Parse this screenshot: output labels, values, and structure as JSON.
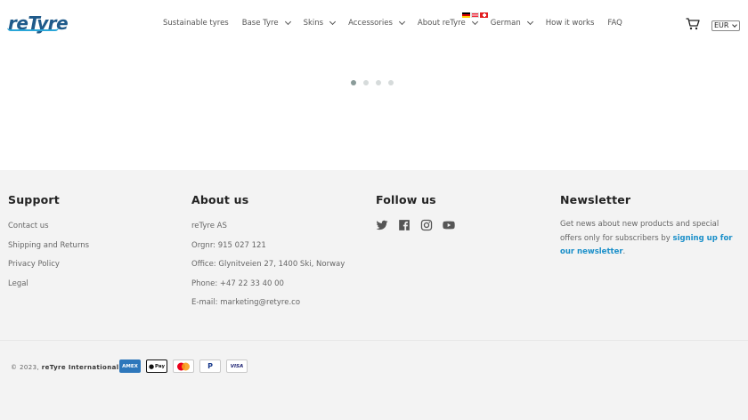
{
  "header": {
    "logo_text": "reTyre",
    "nav": [
      {
        "label": "Sustainable tyres",
        "has_dropdown": false
      },
      {
        "label": "Base Tyre",
        "has_dropdown": true
      },
      {
        "label": "Skins",
        "has_dropdown": true
      },
      {
        "label": "Accessories",
        "has_dropdown": true
      },
      {
        "label": "About reTyre",
        "has_dropdown": true
      },
      {
        "label": "German",
        "has_dropdown": true
      },
      {
        "label": "How it works",
        "has_dropdown": false
      },
      {
        "label": "FAQ",
        "has_dropdown": false
      }
    ],
    "cart_icon": "cart-icon",
    "currency": "EUR"
  },
  "carousel": {
    "slides": 4,
    "active_index": 0
  },
  "footer": {
    "support": {
      "title": "Support",
      "links": [
        "Contact us",
        "Shipping and Returns",
        "Privacy Policy",
        "Legal"
      ]
    },
    "about": {
      "title": "About us",
      "lines": [
        "reTyre AS",
        "Orgnr: 915 027 121",
        "Office: Glynitveien 27, 1400 Ski, Norway",
        "Phone: +47 22 33 40 00",
        "E-mail: marketing@retyre.co"
      ]
    },
    "follow": {
      "title": "Follow us",
      "icons": [
        "twitter-icon",
        "facebook-icon",
        "instagram-icon",
        "youtube-icon"
      ]
    },
    "newsletter": {
      "title": "Newsletter",
      "text": "Get news about new products and special offers only for subscribers by ",
      "link": "signing up for our newsletter",
      "after": "."
    },
    "copyright_prefix": "© 2023,",
    "copyright_brand": "reTyre International",
    "payments": [
      "AMEX",
      "Pay",
      "",
      "P",
      "VISA"
    ],
    "colors": {
      "link": "#1a8fc9",
      "footer_bg": "#f3f3f3",
      "brand": "#1f5a8a"
    }
  }
}
